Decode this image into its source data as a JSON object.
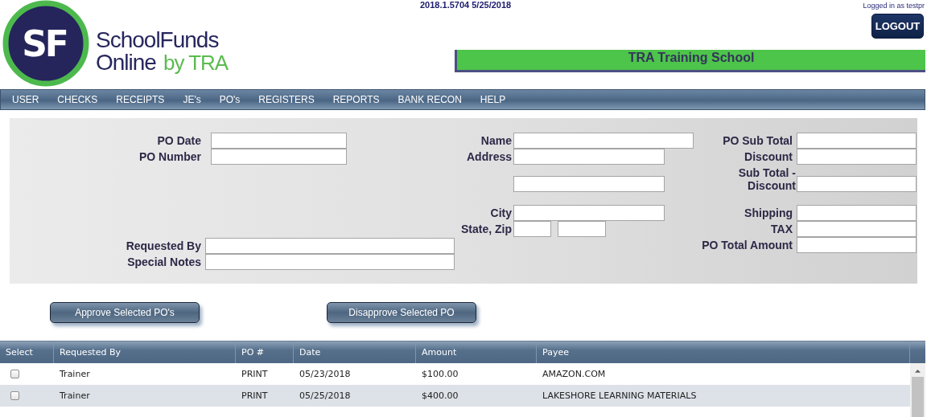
{
  "header": {
    "logo": {
      "mark": "SF",
      "line1": "SchoolFunds",
      "line2": "Online",
      "byline": "by TRA"
    },
    "version": "2018.1.5704 5/25/2018",
    "logged_in": "Logged in as testpr",
    "logout": "LOGOUT",
    "school": "TRA Training School"
  },
  "menu": [
    "USER",
    "CHECKS",
    "RECEIPTS",
    "JE's",
    "PO's",
    "REGISTERS",
    "REPORTS",
    "BANK RECON",
    "HELP"
  ],
  "form": {
    "po_fields": [
      {
        "label": "PO Date",
        "kind": "text"
      },
      {
        "label": "PO Number",
        "kind": "text"
      }
    ],
    "request_fields": [
      {
        "label": "Requested By",
        "kind": "text"
      },
      {
        "label": "Special Notes",
        "kind": "text"
      }
    ],
    "payee_fields": [
      {
        "label": "Name",
        "kind": "wide"
      },
      {
        "label": "Address",
        "kind": "address"
      },
      {
        "label": "City",
        "kind": "text"
      },
      {
        "label": "State, Zip",
        "kind": "state_zip"
      }
    ],
    "totals_fields": [
      {
        "label": "PO Sub Total",
        "kind": "text"
      },
      {
        "label": "Discount",
        "kind": "text"
      },
      {
        "label": "Sub Total - Discount",
        "kind": "wrapped"
      },
      {
        "label": "Shipping",
        "kind": "text"
      },
      {
        "label": "TAX",
        "kind": "text"
      },
      {
        "label": "PO Total Amount",
        "kind": "text"
      }
    ]
  },
  "actions": [
    "Approve Selected PO's",
    "Disapprove Selected PO"
  ],
  "table": {
    "select_column": "Select",
    "columns": [
      "Requested By",
      "PO #",
      "Date",
      "Amount",
      "Payee"
    ],
    "rows": [
      {
        "checked": false,
        "cells": [
          "Trainer",
          "PRINT",
          "05/23/2018",
          "$100.00",
          "AMAZON.COM"
        ]
      },
      {
        "checked": false,
        "cells": [
          "Trainer",
          "PRINT",
          "05/25/2018",
          "$400.00",
          "LAKESHORE LEARNING MATERIALS"
        ]
      }
    ]
  }
}
